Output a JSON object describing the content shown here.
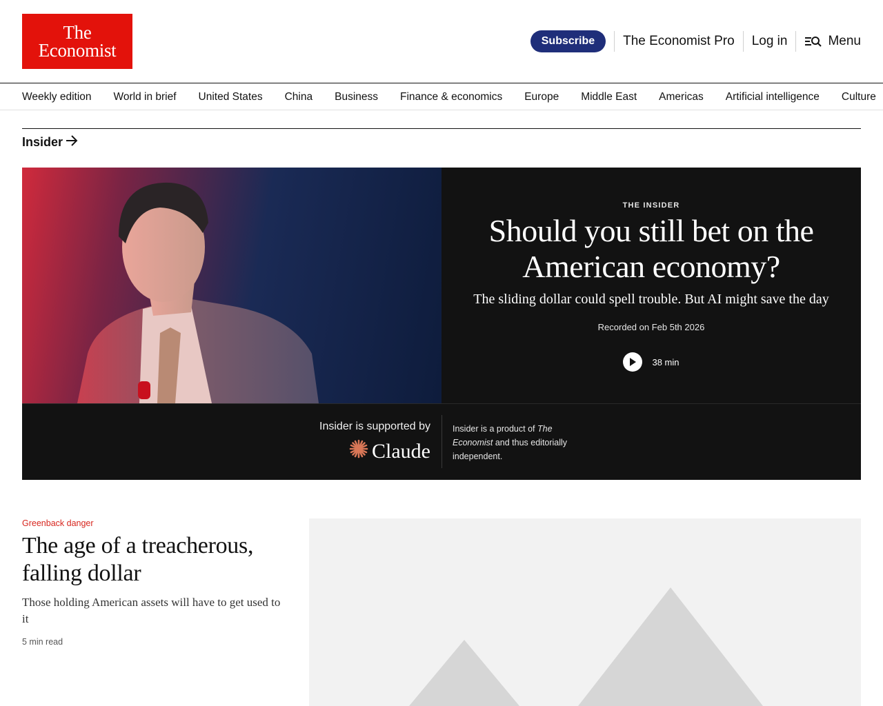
{
  "brand": {
    "logo_line1": "The",
    "logo_line2": "Economist",
    "color": "#e3120b"
  },
  "header": {
    "subscribe_label": "Subscribe",
    "pro_label": "The Economist Pro",
    "login_label": "Log in",
    "menu_label": "Menu",
    "menu_icon": "search-menu-icon"
  },
  "nav": {
    "items": [
      "Weekly edition",
      "World in brief",
      "United States",
      "China",
      "Business",
      "Finance & economics",
      "Europe",
      "Middle East",
      "Americas",
      "Artificial intelligence",
      "Culture"
    ]
  },
  "section": {
    "title": "Insider",
    "arrow_icon": "arrow-right-icon"
  },
  "insider": {
    "kicker": "THE INSIDER",
    "title": "Should you still bet on the American economy?",
    "subtitle": "The sliding dollar could spell trouble. But AI might save the day",
    "recorded": "Recorded on Feb 5th 2026",
    "duration": "38 min",
    "play_icon": "play-icon",
    "sponsor_label": "Insider is supported by",
    "sponsor_name": "Claude",
    "sponsor_icon": "claude-starburst-icon",
    "note_prefix": "Insider is a product of ",
    "note_italic": "The Economist",
    "note_suffix": " and thus editorially independent."
  },
  "story": {
    "flytitle": "Greenback danger",
    "title": "The age of a treacherous, falling dollar",
    "description": "Those holding American assets will have to get used to it",
    "read_time": "5 min read",
    "image_icon": "image-placeholder-icon"
  }
}
